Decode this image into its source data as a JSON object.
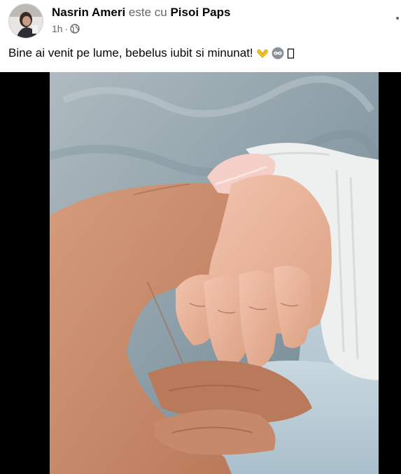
{
  "post": {
    "author": "Nasrin Ameri",
    "with_word": "este cu",
    "tagged": "Pisoi Paps",
    "time": "1h",
    "separator": "·",
    "privacy_icon": "globe-icon",
    "text": "Bine ai venit pe lume, bebelus iubit si minunat!",
    "emojis": [
      "heart-hands-emoji",
      "infinity-emoji",
      "missing-glyph-emoji"
    ]
  },
  "colors": {
    "secondary_text": "#65676b",
    "primary_text": "#050505",
    "blanket": "#8fa3ad",
    "skin": "#c98c6e",
    "nail": "#f3c9c2"
  }
}
